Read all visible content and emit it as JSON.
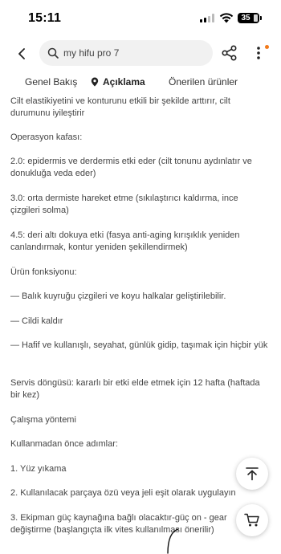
{
  "status_bar": {
    "time": "15:11",
    "battery": "35",
    "icons": [
      "signal-icon",
      "wifi-icon",
      "battery-icon"
    ]
  },
  "search": {
    "query": "my hifu pro 7"
  },
  "header_icons": [
    "back-arrow-icon",
    "search-icon",
    "share-icon",
    "more-vertical-icon"
  ],
  "colors": {
    "accent": "#f27a1a",
    "text": "#444444",
    "search_bg": "#f1f1f1"
  },
  "tabs": [
    {
      "label": "Genel Bakış",
      "active": false
    },
    {
      "label": "Açıklama",
      "active": true,
      "icon": "location-pin-icon"
    },
    {
      "label": "Önerilen ürünler",
      "active": false
    }
  ],
  "description": [
    "Cilt elastikiyetini ve konturunu etkili bir şekilde arttırır, cilt durumunu iyileştirir",
    "Operasyon kafası:",
    "2.0: epidermis ve derdermis etki eder (cilt tonunu aydınlatır ve donukluğa veda eder)",
    "3.0: orta dermiste hareket etme (sıkılaştırıcı kaldırma, ince çizgileri solma)",
    "4.5: deri altı dokuya etki (fasya anti-aging kırışıklık yeniden canlandırmak, kontur yeniden şekillendirmek)",
    "Ürün fonksiyonu:",
    "— Balık kuyruğu çizgileri ve koyu halkalar geliştirilebilir.",
    "— Cildi kaldır",
    "— Hafif ve kullanışlı, seyahat, günlük gidip, taşımak için hiçbir yük",
    "Servis döngüsü: kararlı bir etki elde etmek için 12 hafta (haftada bir kez)",
    "Çalışma yöntemi",
    "Kullanmadan önce adımlar:",
    "1. Yüz yıkama",
    "2. Kullanılacak parçaya özü veya jeli eşit olarak uygulayın",
    "3. Ekipman güç kaynağına bağlı olacaktır-güç on - gear değiştirme (başlangıçta ilk vites kullanılması önerilir)"
  ],
  "floating_buttons": [
    "scroll-to-top-icon",
    "cart-icon"
  ]
}
